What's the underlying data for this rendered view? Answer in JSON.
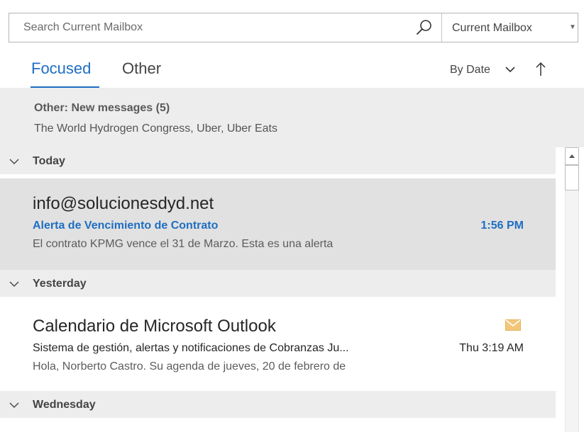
{
  "search": {
    "placeholder": "Search Current Mailbox",
    "scope": "Current Mailbox"
  },
  "tabs": {
    "focused": "Focused",
    "other": "Other",
    "active": "Focused"
  },
  "sort": {
    "by": "By Date",
    "direction": "ascending"
  },
  "other_banner": {
    "title": "Other: New messages (5)",
    "senders": "The World Hydrogen Congress, Uber, Uber Eats"
  },
  "groups": [
    {
      "label": "Today",
      "messages": [
        {
          "sender": "info@solucionesdyd.net",
          "subject": "Alerta de Vencimiento de Contrato",
          "preview": "El contrato KPMG vence el 31 de Marzo.  Esta es una alerta",
          "time": "1:56 PM",
          "unread": true,
          "selected": true
        }
      ]
    },
    {
      "label": "Yesterday",
      "messages": [
        {
          "sender": "Calendario de Microsoft Outlook",
          "subject": "Sistema de gestión, alertas y notificaciones de Cobranzas Ju...",
          "preview": "Hola, Norberto Castro.  Su agenda de jueves, 20 de febrero de",
          "time": "Thu 3:19 AM",
          "unread": false,
          "selected": false,
          "icon": "envelope-icon"
        }
      ]
    },
    {
      "label": "Wednesday",
      "messages": []
    }
  ],
  "colors": {
    "accent": "#1e6ec3",
    "unread_subject": "#1e6ec3",
    "envelope": "#f2c77a",
    "selected_row": "#e1e1e1",
    "header_bg": "#ededed"
  }
}
